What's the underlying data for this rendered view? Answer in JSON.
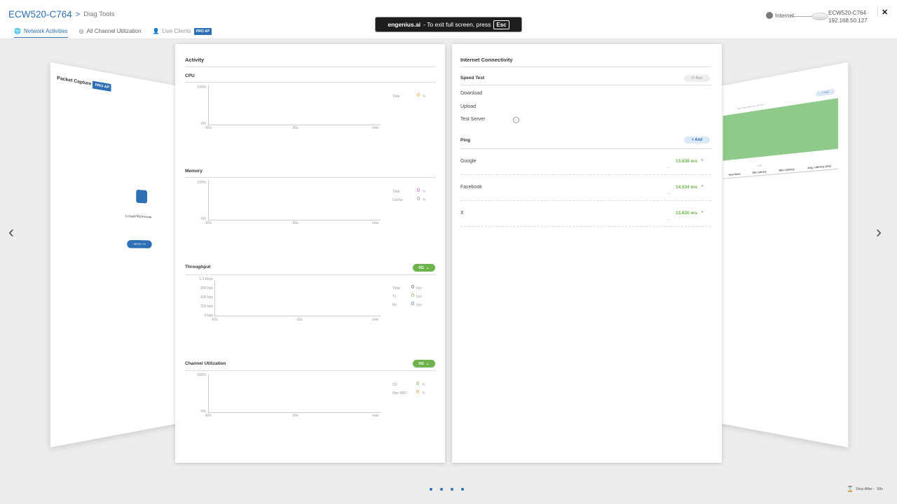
{
  "header": {
    "device": "ECW520-C764",
    "separator": ">",
    "tool": "Diag Tools",
    "tabs": [
      {
        "label": "Network Activities",
        "icon": "globe-icon"
      },
      {
        "label": "All Channel Utilization",
        "icon": "satellite-icon"
      },
      {
        "label": "Live Clients",
        "icon": "person-icon",
        "badge": "PRO AP"
      }
    ],
    "banner": {
      "domain": "engenius.ai",
      "text": " - To exit full screen, press",
      "key": "Esc"
    },
    "internet": "Internet",
    "device_name": "ECW520-C764",
    "device_ip": "192.168.50.127",
    "close": "✕"
  },
  "left_panel": {
    "title": "Packet Capture",
    "badge": "PRO AP",
    "locked": "Locked PRO Feature",
    "button": "Upgrade now"
  },
  "right_panel": {
    "hint": "Item view graph out | See list ↗",
    "button": "↗ New",
    "col_label": "ICMP",
    "columns": [
      "Host Name",
      "Min Latency",
      "Max Latency",
      "Avg. Latency (ms)"
    ]
  },
  "activity": {
    "title": "Activity",
    "cpu": {
      "label": "CPU",
      "ymax": "100%",
      "ymin": "0%",
      "x": [
        "-60s",
        "-30s",
        "now"
      ],
      "legend": [
        {
          "k": "Total",
          "v": "0",
          "u": "%",
          "c": "#f0932b"
        }
      ]
    },
    "memory": {
      "label": "Memory",
      "ymax": "100%",
      "ymin": "0%",
      "x": [
        "-60s",
        "-30s",
        "now"
      ],
      "legend": [
        {
          "k": "Total",
          "v": "0",
          "u": "%",
          "c": "#b03fd0"
        },
        {
          "k": "Cache",
          "v": "0",
          "u": "%",
          "c": "#888888"
        }
      ]
    },
    "throughput": {
      "label": "Throughput",
      "band": "5G",
      "y": [
        "1.3 Kbps",
        "999 bps",
        "666 bps",
        "333 bps",
        "0 bps"
      ],
      "x": [
        "-60s",
        "-30s",
        "now"
      ],
      "legend": [
        {
          "k": "Total",
          "v": "0",
          "u": "bps",
          "c": "#555555"
        },
        {
          "k": "Tx",
          "v": "0",
          "u": "bps",
          "c": "#6db24c"
        },
        {
          "k": "Rx",
          "v": "0",
          "u": "bps",
          "c": "#2f6fb5"
        }
      ]
    },
    "channel": {
      "label": "Channel Utilization",
      "band": "5G",
      "ymax": "100%",
      "ymin": "0%",
      "x": [
        "-60s",
        "-30s",
        "now"
      ],
      "legend": [
        {
          "k": "Ch",
          "v": "0",
          "u": "%",
          "c": "#6db24c"
        },
        {
          "k": "Non WiFi",
          "v": "0",
          "u": "%",
          "c": "#f0932b"
        }
      ]
    }
  },
  "connectivity": {
    "title": "Internet Connectivity",
    "speed_test": "Speed Test",
    "run": "Run",
    "rows": [
      "Download",
      "Upload",
      "Test Server"
    ],
    "ping": "Ping",
    "add": "+ Add",
    "hosts": [
      {
        "name": "Google",
        "value": "13.838 ms",
        "sub": "-"
      },
      {
        "name": "Facebook",
        "value": "14.534 ms",
        "sub": "-"
      },
      {
        "name": "X",
        "value": "13.830 ms",
        "sub": "-"
      }
    ]
  },
  "footer": {
    "pages": 4,
    "stop_label": "Stop After :",
    "stop_value": "58s"
  },
  "colors": {
    "accent": "#2f6fb5",
    "green": "#6db24c"
  }
}
